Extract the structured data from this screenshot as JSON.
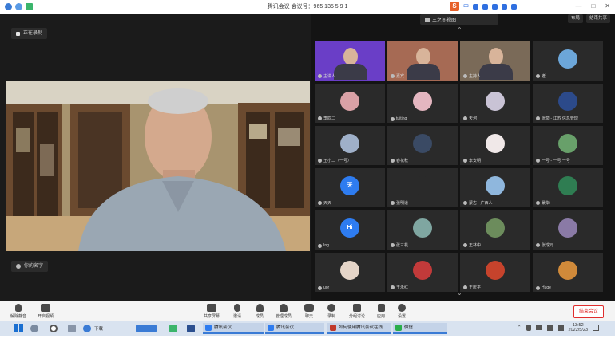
{
  "titlebar": {
    "title": "腾讯会议  会议号：965 135 5 9 1",
    "ime_label": "中",
    "controls": [
      "—",
      "□",
      "✕"
    ]
  },
  "meeting": {
    "recording_label": "正在录制",
    "speaker_name": "你的名字",
    "panel_title": "三之间视图",
    "top_buttons": [
      "布局",
      "结束共享"
    ],
    "participants": [
      {
        "name": "主讲人",
        "type": "video",
        "color": "#6a3ec7"
      },
      {
        "name": "嘉宾",
        "type": "video",
        "color": "#a66a54"
      },
      {
        "name": "主持人",
        "type": "video",
        "color": "#7a6a58"
      },
      {
        "name": "老",
        "type": "avatar",
        "color": "#6ca6d9"
      },
      {
        "name": "李四二",
        "type": "avatar",
        "color": "#d9a1a6"
      },
      {
        "name": "tuiting",
        "type": "avatar",
        "color": "#e4b6c0"
      },
      {
        "name": "天河",
        "type": "avatar",
        "color": "#c9c3d5"
      },
      {
        "name": "张泉 - 江苏 信息管理",
        "type": "avatar",
        "color": "#2c4a8a"
      },
      {
        "name": "王小二（一号）",
        "type": "avatar",
        "color": "#9fb0c9"
      },
      {
        "name": "春花秋",
        "type": "avatar",
        "color": "#3a4a64"
      },
      {
        "name": "李安明",
        "type": "avatar",
        "color": "#f0e8e8"
      },
      {
        "name": "一号 - 一号 一号",
        "type": "avatar",
        "color": "#68a06a"
      },
      {
        "name": "天天",
        "type": "letter",
        "letter": "天",
        "color": "#2e7cf0"
      },
      {
        "name": "张明道",
        "type": "avatar",
        "color": "#2a2a2a"
      },
      {
        "name": "蒙古 - 广西人",
        "type": "avatar",
        "color": "#8fb7dd"
      },
      {
        "name": "景华",
        "type": "avatar",
        "color": "#2f7d52"
      },
      {
        "name": "Ing",
        "type": "letter",
        "letter": "Hi",
        "color": "#2e7cf0"
      },
      {
        "name": "张三机",
        "type": "avatar",
        "color": "#7fa6a1"
      },
      {
        "name": "王林中",
        "type": "avatar",
        "color": "#6c8c5c"
      },
      {
        "name": "张成元",
        "type": "avatar",
        "color": "#8a7aa6"
      },
      {
        "name": "uor",
        "type": "avatar",
        "color": "#e5d5c8"
      },
      {
        "name": "王永红",
        "type": "avatar",
        "color": "#c23a3a"
      },
      {
        "name": "王庆平",
        "type": "avatar",
        "color": "#c6432c"
      },
      {
        "name": "Huge",
        "type": "avatar",
        "color": "#d08a3a"
      }
    ]
  },
  "toolbar": {
    "left": [
      {
        "label": "解除静音",
        "icon": "microphone-icon"
      },
      {
        "label": "开启视频",
        "icon": "camera-icon"
      }
    ],
    "center": [
      {
        "label": "共享屏幕",
        "icon": "share-screen-icon"
      },
      {
        "label": "邀请",
        "icon": "invite-icon"
      },
      {
        "label": "成员",
        "icon": "members-icon"
      },
      {
        "label": "管理成员",
        "icon": "manage-members-icon"
      },
      {
        "label": "聊天",
        "icon": "chat-icon"
      },
      {
        "label": "录制",
        "icon": "record-icon"
      },
      {
        "label": "分组讨论",
        "icon": "breakout-icon"
      },
      {
        "label": "应用",
        "icon": "apps-icon"
      },
      {
        "label": "设置",
        "icon": "settings-icon"
      }
    ],
    "end_label": "结束会议"
  },
  "taskbar": {
    "search_text": "下载",
    "apps": [
      "腾讯会议",
      "腾讯会议",
      "如何使用腾讯会议在线...",
      "微信"
    ],
    "time": "13:52",
    "date": "2022/5/23"
  },
  "colors": {
    "meeting_bg": "#1e1e1e",
    "end_red": "#e02d2d",
    "avatar_blue": "#2e7cf0",
    "taskbar": "#d9e3f0"
  }
}
